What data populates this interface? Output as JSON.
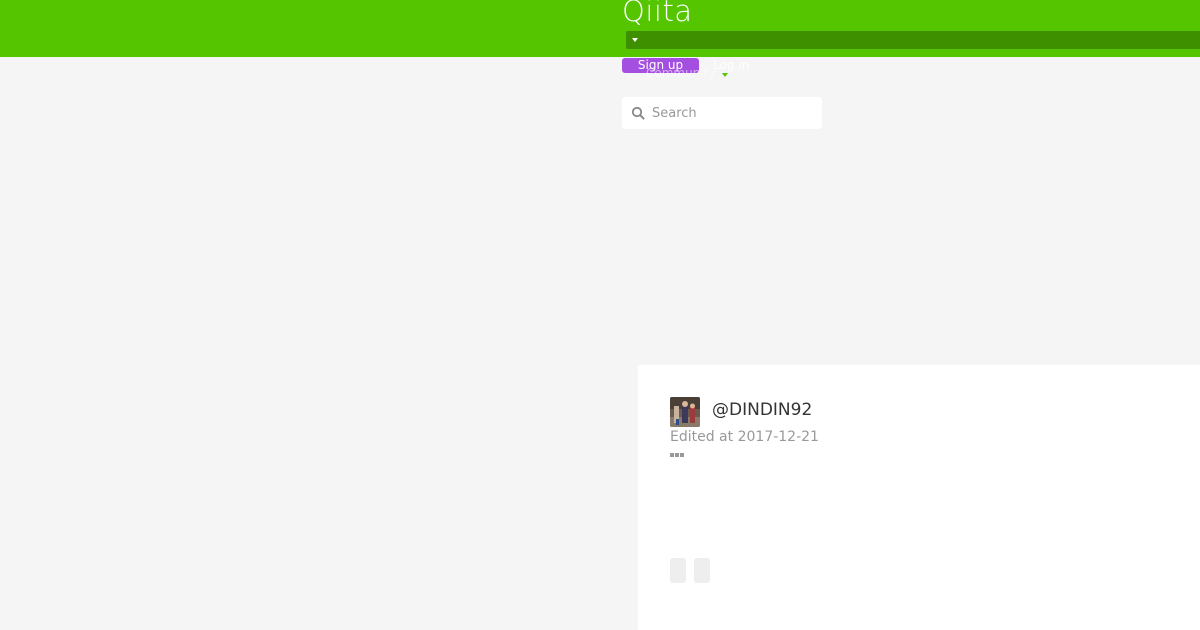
{
  "header": {
    "logo": "Qiita",
    "signup_label": "Sign up",
    "login_label": "Log in",
    "community_label": "Community",
    "brand_color": "#55c500",
    "signup_color": "#a44fe0"
  },
  "search": {
    "placeholder": "Search"
  },
  "article": {
    "author": "@DINDIN92",
    "edited_prefix": "Edited at",
    "edited_date": "2017-12-21"
  },
  "icons": [
    "caret-down-icon",
    "search-icon",
    "avatar",
    "more-icon"
  ]
}
